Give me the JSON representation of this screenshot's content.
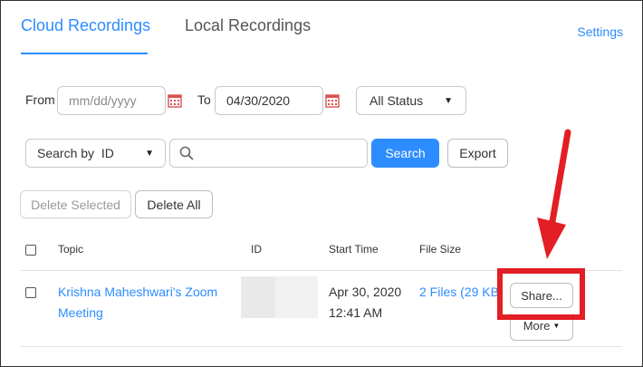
{
  "tabs": {
    "cloud": "Cloud Recordings",
    "local": "Local Recordings"
  },
  "header": {
    "settings": "Settings"
  },
  "filters": {
    "from_label": "From",
    "from_placeholder": "mm/dd/yyyy",
    "to_label": "To",
    "to_value": "04/30/2020",
    "status": "All Status",
    "search_by": "Search by  ID",
    "search_value": "",
    "search_button": "Search",
    "export_button": "Export"
  },
  "actions": {
    "delete_selected": "Delete Selected",
    "delete_all": "Delete All"
  },
  "table": {
    "columns": [
      "Topic",
      "ID",
      "Start Time",
      "File Size"
    ],
    "rows": [
      {
        "topic_line1": "Krishna Maheshwari's Zoom",
        "topic_line2": "Meeting",
        "start_date": "Apr 30, 2020",
        "start_time": "12:41 AM",
        "file_size": "2 Files (29 KB)",
        "share_button": "Share...",
        "more_button": "More"
      }
    ]
  },
  "colors": {
    "accent": "#2d8cff",
    "annotation": "#e31e24",
    "calendar_icon": "#d9534f"
  }
}
